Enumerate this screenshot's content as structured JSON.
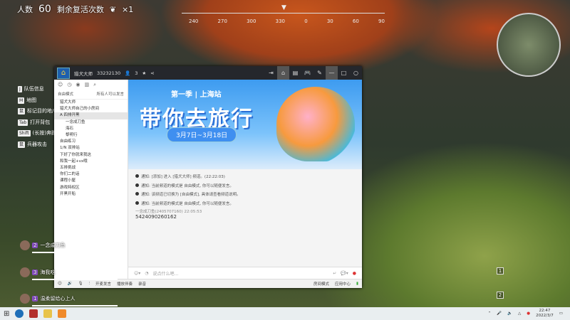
{
  "hud": {
    "players_label": "人数",
    "players": "60",
    "revive_label": "剩余复活次数",
    "revive_count": "×1"
  },
  "compass": {
    "ticks": [
      "240",
      "270",
      "300",
      "330",
      "0",
      "30",
      "60",
      "90"
    ]
  },
  "hints": [
    {
      "key": "J",
      "label": "队伍信息"
    },
    {
      "key": "M",
      "label": "地图"
    },
    {
      "key": "鼠",
      "label": "标记目的地/物"
    },
    {
      "key": "Tab",
      "label": "打开背包"
    },
    {
      "key": "Shift",
      "label": "(长按)奔跑"
    },
    {
      "key": "鼠",
      "label": "兵器攻击"
    }
  ],
  "yy": {
    "title": "猎犬大师",
    "room_id": "33232130",
    "online": "3",
    "left": {
      "mode": "自由模式",
      "hint": "所有人可以发言",
      "items": [
        {
          "label": "猎犬大师",
          "cls": ""
        },
        {
          "label": "猎犬大师自己的小房间",
          "cls": ""
        },
        {
          "label": "A 四排开黑",
          "cls": "sel"
        },
        {
          "label": "一念成刀鱼",
          "cls": "sub"
        },
        {
          "label": "海石",
          "cls": "sub"
        },
        {
          "label": "黎明行",
          "cls": "sub"
        },
        {
          "label": "自由练习",
          "cls": ""
        },
        {
          "label": "1/N 双排站",
          "cls": ""
        },
        {
          "label": "下好了你就来我这",
          "cls": ""
        },
        {
          "label": "和我一起+vx哦",
          "cls": ""
        },
        {
          "label": "五排挑战",
          "cls": ""
        },
        {
          "label": "你们二的话",
          "cls": ""
        },
        {
          "label": "课程小屋",
          "cls": ""
        },
        {
          "label": "游戏特权区",
          "cls": ""
        },
        {
          "label": "开黑开船",
          "cls": ""
        }
      ]
    },
    "banner": {
      "season": "第一季 | 上海站",
      "title": "带你去旅行",
      "dates": "3月7日~3月18日"
    },
    "chat": [
      "通知: [添加] 进入 [猎犬大师] 频道。(22:22:03)",
      "通知: 当前频道的模式是 自由模式, 你可以随便发言。",
      "通知: 该频道已切换为 [自由模式], 具体请查看频道说明。",
      "通知: 当前频道的模式是 自由模式, 你可以随便发言。"
    ],
    "message": {
      "sender": "一念成刀鱼(2405707160) 22:05:53",
      "text": "5424090260162"
    },
    "input_placeholder": "说点什么吧...",
    "bottom": {
      "music": "播放伴奏",
      "record": "录音",
      "settings": "房间模式",
      "app_center": "应用中心",
      "voice": "开麦发言"
    }
  },
  "feed": [
    {
      "name": "一念成刀鱼",
      "badge": "2"
    },
    {
      "name": "海我吃",
      "badge": "3"
    },
    {
      "name": "温柔留给心上人",
      "badge": "1"
    }
  ],
  "markers": [
    "1",
    "2"
  ],
  "tray": {
    "time": "22:47",
    "date": "2022/3/7"
  }
}
